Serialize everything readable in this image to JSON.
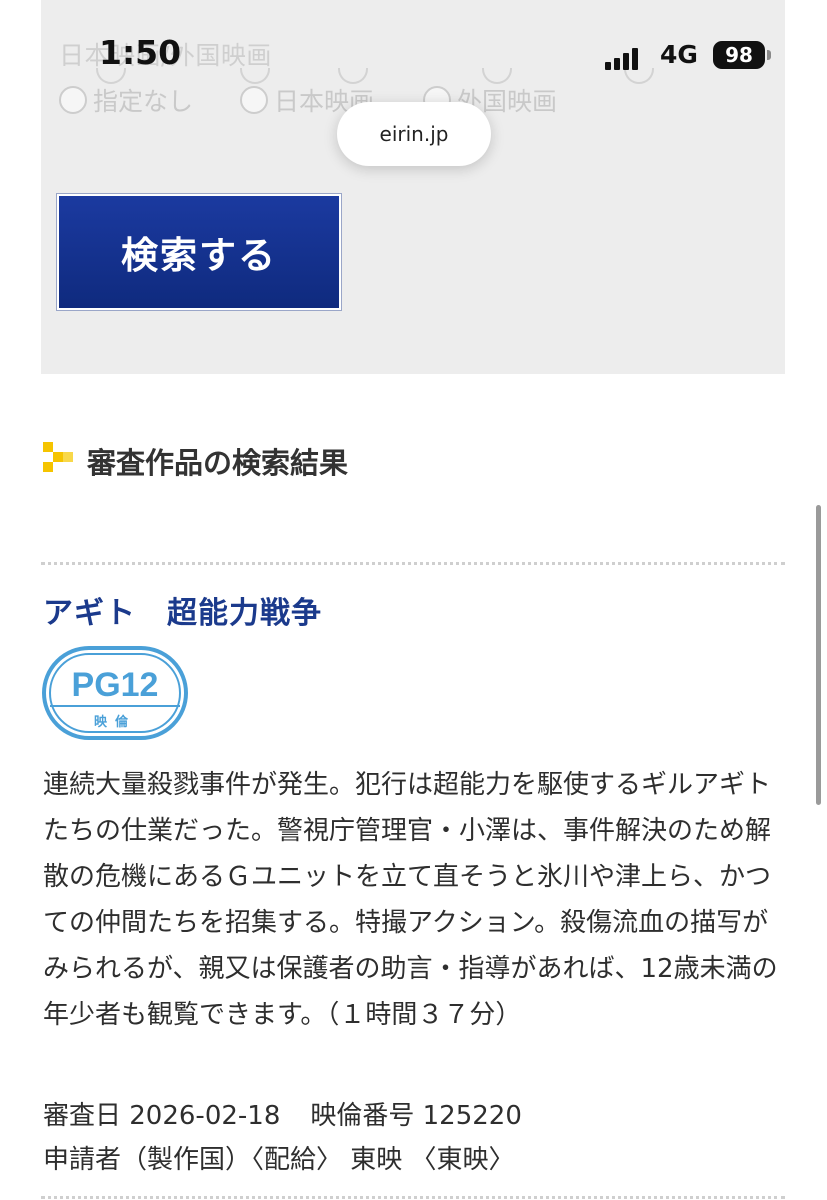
{
  "status_bar": {
    "time": "1:50",
    "network": "4G",
    "battery": "98"
  },
  "browser": {
    "url": "eirin.jp"
  },
  "search_form": {
    "filter_label": "日本映画/外国映画",
    "options": [
      "指定なし",
      "日本映画",
      "外国映画"
    ],
    "submit_label": "検索する"
  },
  "results": {
    "section_title": "審査作品の検索結果",
    "items": [
      {
        "title": "アギト　超能力戦争",
        "rating": "PG12",
        "rating_sub": "映倫",
        "description": "連続大量殺戮事件が発生。犯行は超能力を駆使するギルアギトたちの仕業だった。警視庁管理官・小澤は、事件解決のため解散の危機にあるＧユニットを立て直そうと氷川や津上ら、かつての仲間たちを招集する。特撮アクション。殺傷流血の描写がみられるが、親又は保護者の助言・指導があれば、12歳未満の年少者も観覧できます。（１時間３７分）",
        "review_date": "審査日 2026-02-18",
        "eirin_number": "映倫番号 125220",
        "applicant": "申請者（製作国）〈配給〉 東映 〈東映〉"
      }
    ]
  },
  "colors": {
    "button": "#1b3aa0",
    "title": "#1b3a8c",
    "badge": "#4aa0d8",
    "icon": "#f5c400"
  }
}
